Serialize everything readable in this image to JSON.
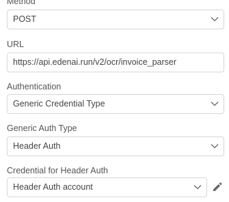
{
  "fields": {
    "method": {
      "label": "Method",
      "value": "POST"
    },
    "url": {
      "label": "URL",
      "value": "https://api.edenai.run/v2/ocr/invoice_parser"
    },
    "authentication": {
      "label": "Authentication",
      "value": "Generic Credential Type"
    },
    "generic_auth_type": {
      "label": "Generic Auth Type",
      "value": "Header Auth"
    },
    "credential": {
      "label": "Credential for Header Auth",
      "value": "Header Auth account"
    }
  },
  "icons": {
    "dropdown": "chevron-down-icon",
    "edit": "pencil-icon"
  },
  "colors": {
    "label_text": "#555555",
    "value_text": "#444444",
    "border": "#d6d6d6",
    "icon": "#666666"
  }
}
